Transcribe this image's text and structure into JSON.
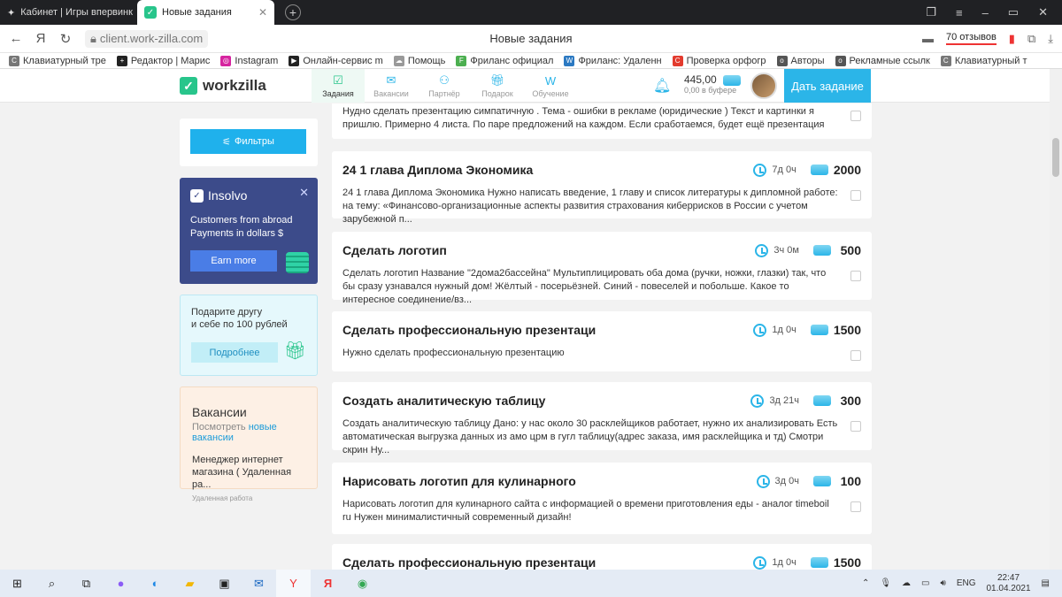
{
  "browser": {
    "tabs": [
      {
        "title": "Кабинет | Игры впервинк",
        "active": false
      },
      {
        "title": "Новые задания",
        "active": true
      }
    ],
    "url": "client.work-zilla.com",
    "page_title": "Новые задания",
    "reviews": "70 отзывов",
    "bookmarks": [
      {
        "label": "Клавиатурный тре",
        "icon": "c-icon",
        "color": "#777777"
      },
      {
        "label": "Редактор | Марис",
        "icon": "plus-icon",
        "color": "#222222"
      },
      {
        "label": "Instagram",
        "icon": "instagram-icon",
        "color": "#d6249f"
      },
      {
        "label": "Онлайн-сервис m",
        "icon": "media-icon",
        "color": "#222222"
      },
      {
        "label": "Помощь",
        "icon": "cloud-icon",
        "color": "#999999"
      },
      {
        "label": "Фриланс официал",
        "icon": "f-icon",
        "color": "#4caf50"
      },
      {
        "label": "Фриланс: Удаленн",
        "icon": "w-icon",
        "color": "#2b79c2"
      },
      {
        "label": "Проверка орфогр",
        "icon": "c-icon",
        "color": "#e33b2e"
      },
      {
        "label": "Авторы",
        "icon": "ok-icon",
        "color": "#555555"
      },
      {
        "label": "Рекламные ссылк",
        "icon": "ok-icon",
        "color": "#555555"
      },
      {
        "label": "Клавиатурный т",
        "icon": "c-icon",
        "color": "#777777"
      }
    ]
  },
  "header": {
    "logo": "workzilla",
    "nav": [
      {
        "label": "Задания",
        "icon": "tasks-icon",
        "active": true
      },
      {
        "label": "Вакансии",
        "icon": "vacancies-icon",
        "active": false
      },
      {
        "label": "Партнёр",
        "icon": "partner-icon",
        "active": false
      },
      {
        "label": "Подарок",
        "icon": "gift-icon",
        "active": false
      },
      {
        "label": "Обучение",
        "icon": "education-icon",
        "active": false
      }
    ],
    "balance": "445,00",
    "balance_note": "0,00 в буфере",
    "give_task": "Дать задание"
  },
  "sidebar": {
    "filters_label": "Фильтры",
    "insolvo": {
      "name": "Insolvo",
      "line1": "Customers from abroad",
      "line2": "Payments in dollars $",
      "button": "Earn more"
    },
    "referral": {
      "line1": "Подарите другу",
      "line2": "и себе по 100 рублей",
      "button": "Подробнее"
    },
    "vacancies": {
      "title": "Вакансии",
      "prefix": "Посмотреть",
      "link": "новые вакансии",
      "job": "Менеджер интернет магазина ( Удаленная ра...",
      "tag": "Удаленная работа"
    }
  },
  "tasks": [
    {
      "title": "",
      "time": "",
      "price": "",
      "desc": "Нудно сделать презентацию симпатичную . Тема - ошибки в рекламе (юридические ) Текст и картинки я пришлю. Примерно 4 листа. По паре предложений на каждом. Если сработаемся, будет ещё презентация"
    },
    {
      "title": "24 1 глава Диплома Экономика",
      "time": "7д 0ч",
      "price": "2000",
      "desc": "24 1 глава Диплома Экономика Нужно написать введение, 1 главу и список литературы к дипломной работе: на тему: «Финансово-организационные аспекты развития страхования киберрисков в России с учетом зарубежной п..."
    },
    {
      "title": "Сделать логотип",
      "time": "3ч 0м",
      "price": "500",
      "desc": "Сделать логотип Название \"2дома2бассейна\" Мультиплицировать оба дома (ручки, ножки, глазки) так, что бы сразу узнавался нужный дом! Жёлтый - посерьёзней. Синий - повеселей и побольше. Какое то интересное соединение/вз..."
    },
    {
      "title": "Сделать профессиональную презентаци",
      "time": "1д 0ч",
      "price": "1500",
      "desc": "Нужно сделать профессиональную презентацию"
    },
    {
      "title": "Создать аналитическую таблицу",
      "time": "3д 21ч",
      "price": "300",
      "desc": "Создать аналитическую таблицу Дано: у нас около 30 расклейщиков работает, нужно их анализировать Есть автоматическая выгрузка данных из амо црм в гугл таблицу(адрес заказа, имя расклейщика и тд) Смотри скрин Ну..."
    },
    {
      "title": "Нарисовать логотип для кулинарного",
      "time": "3д 0ч",
      "price": "100",
      "desc": "Нарисовать логотип для кулинарного сайта с информацией о времени приготовления еды - аналог timeboil ru Нужен минималистичный современный дизайн!"
    },
    {
      "title": "Сделать профессиональную презентаци",
      "time": "1д 0ч",
      "price": "1500",
      "desc": ""
    }
  ],
  "taskbar": {
    "lang": "ENG",
    "time": "22:47",
    "date": "01.04.2021"
  }
}
